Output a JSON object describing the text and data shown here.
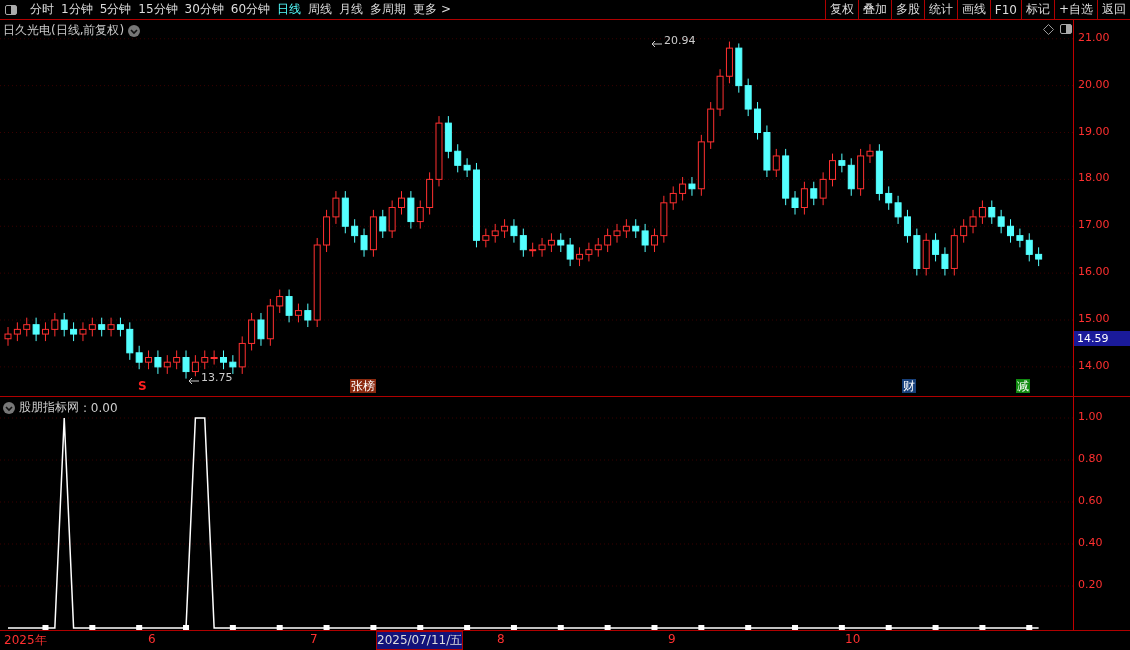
{
  "toolbar": {
    "periods": [
      {
        "label": "分时",
        "selected": false
      },
      {
        "label": "1分钟",
        "selected": false
      },
      {
        "label": "5分钟",
        "selected": false
      },
      {
        "label": "15分钟",
        "selected": false
      },
      {
        "label": "30分钟",
        "selected": false
      },
      {
        "label": "60分钟",
        "selected": false
      },
      {
        "label": "日线",
        "selected": true
      },
      {
        "label": "周线",
        "selected": false
      },
      {
        "label": "月线",
        "selected": false
      },
      {
        "label": "多周期",
        "selected": false
      },
      {
        "label": "更多 >",
        "selected": false
      }
    ],
    "actions": [
      "复权",
      "叠加",
      "多股",
      "统计",
      "画线",
      "F10",
      "标记",
      "+自选",
      "返回"
    ]
  },
  "main_chart": {
    "title": "日久光电(日线,前复权)",
    "last_price": "14.59",
    "high_label": "20.94",
    "low_label": "13.75",
    "chart_data": {
      "type": "candlestick",
      "grid": true,
      "ylim": [
        13.4,
        21.4
      ],
      "yticks": [
        {
          "value": 21,
          "label": "21.00"
        },
        {
          "value": 20,
          "label": "20.00"
        },
        {
          "value": 19,
          "label": "19.00"
        },
        {
          "value": 18,
          "label": "18.00"
        },
        {
          "value": 17,
          "label": "17.00"
        },
        {
          "value": 16,
          "label": "16.00"
        },
        {
          "value": 15,
          "label": "15.00"
        },
        {
          "value": 14,
          "label": "14.00"
        }
      ],
      "ohlc": [
        [
          14.6,
          14.85,
          14.45,
          14.7
        ],
        [
          14.7,
          14.95,
          14.55,
          14.8
        ],
        [
          14.8,
          15.05,
          14.65,
          14.9
        ],
        [
          14.9,
          15.05,
          14.55,
          14.7
        ],
        [
          14.7,
          14.95,
          14.55,
          14.8
        ],
        [
          14.8,
          15.15,
          14.65,
          15.0
        ],
        [
          15.0,
          15.15,
          14.65,
          14.8
        ],
        [
          14.8,
          14.95,
          14.55,
          14.7
        ],
        [
          14.7,
          14.95,
          14.55,
          14.8
        ],
        [
          14.8,
          15.05,
          14.65,
          14.9
        ],
        [
          14.9,
          15.05,
          14.65,
          14.8
        ],
        [
          14.8,
          15.05,
          14.65,
          14.9
        ],
        [
          14.9,
          15.05,
          14.65,
          14.8
        ],
        [
          14.8,
          14.95,
          14.15,
          14.3
        ],
        [
          14.3,
          14.45,
          13.95,
          14.1
        ],
        [
          14.1,
          14.35,
          13.95,
          14.2
        ],
        [
          14.2,
          14.35,
          13.85,
          14.0
        ],
        [
          14.0,
          14.25,
          13.85,
          14.1
        ],
        [
          14.1,
          14.35,
          13.95,
          14.2
        ],
        [
          14.2,
          14.35,
          13.75,
          13.9
        ],
        [
          13.9,
          14.25,
          13.8,
          14.1
        ],
        [
          14.1,
          14.35,
          13.95,
          14.2
        ],
        [
          14.2,
          14.35,
          14.05,
          14.2
        ],
        [
          14.2,
          14.35,
          13.95,
          14.1
        ],
        [
          14.1,
          14.25,
          13.85,
          14.0
        ],
        [
          14.0,
          14.65,
          13.85,
          14.5
        ],
        [
          14.5,
          15.15,
          14.35,
          15.0
        ],
        [
          15.0,
          15.15,
          14.45,
          14.6
        ],
        [
          14.6,
          15.45,
          14.45,
          15.3
        ],
        [
          15.3,
          15.65,
          15.15,
          15.5
        ],
        [
          15.5,
          15.65,
          14.95,
          15.1
        ],
        [
          15.1,
          15.35,
          14.95,
          15.2
        ],
        [
          15.2,
          15.35,
          14.85,
          15.0
        ],
        [
          15.0,
          16.75,
          14.85,
          16.6
        ],
        [
          16.6,
          17.35,
          16.45,
          17.2
        ],
        [
          17.2,
          17.75,
          17.05,
          17.6
        ],
        [
          17.6,
          17.75,
          16.85,
          17.0
        ],
        [
          17.0,
          17.15,
          16.65,
          16.8
        ],
        [
          16.8,
          16.95,
          16.35,
          16.5
        ],
        [
          16.5,
          17.35,
          16.35,
          17.2
        ],
        [
          17.2,
          17.35,
          16.75,
          16.9
        ],
        [
          16.9,
          17.55,
          16.75,
          17.4
        ],
        [
          17.4,
          17.75,
          17.25,
          17.6
        ],
        [
          17.6,
          17.75,
          16.95,
          17.1
        ],
        [
          17.1,
          17.55,
          16.95,
          17.4
        ],
        [
          17.4,
          18.15,
          17.25,
          18.0
        ],
        [
          18.0,
          19.35,
          17.85,
          19.2
        ],
        [
          19.2,
          19.35,
          18.45,
          18.6
        ],
        [
          18.6,
          18.75,
          18.15,
          18.3
        ],
        [
          18.3,
          18.45,
          18.05,
          18.2
        ],
        [
          18.2,
          18.35,
          16.55,
          16.7
        ],
        [
          16.7,
          16.95,
          16.55,
          16.8
        ],
        [
          16.8,
          17.05,
          16.65,
          16.9
        ],
        [
          16.9,
          17.15,
          16.75,
          17.0
        ],
        [
          17.0,
          17.15,
          16.65,
          16.8
        ],
        [
          16.8,
          16.95,
          16.35,
          16.5
        ],
        [
          16.5,
          16.65,
          16.35,
          16.5
        ],
        [
          16.5,
          16.75,
          16.35,
          16.6
        ],
        [
          16.6,
          16.85,
          16.45,
          16.7
        ],
        [
          16.7,
          16.85,
          16.45,
          16.6
        ],
        [
          16.6,
          16.75,
          16.15,
          16.3
        ],
        [
          16.3,
          16.55,
          16.15,
          16.4
        ],
        [
          16.4,
          16.65,
          16.25,
          16.5
        ],
        [
          16.5,
          16.75,
          16.35,
          16.6
        ],
        [
          16.6,
          16.95,
          16.45,
          16.8
        ],
        [
          16.8,
          17.05,
          16.65,
          16.9
        ],
        [
          16.9,
          17.15,
          16.75,
          17.0
        ],
        [
          17.0,
          17.15,
          16.75,
          16.9
        ],
        [
          16.9,
          17.05,
          16.45,
          16.6
        ],
        [
          16.6,
          16.95,
          16.45,
          16.8
        ],
        [
          16.8,
          17.65,
          16.65,
          17.5
        ],
        [
          17.5,
          17.85,
          17.35,
          17.7
        ],
        [
          17.7,
          18.05,
          17.55,
          17.9
        ],
        [
          17.9,
          18.05,
          17.65,
          17.8
        ],
        [
          17.8,
          18.95,
          17.65,
          18.8
        ],
        [
          18.8,
          19.65,
          18.65,
          19.5
        ],
        [
          19.5,
          20.35,
          19.35,
          20.2
        ],
        [
          20.2,
          20.94,
          20.05,
          20.8
        ],
        [
          20.8,
          20.9,
          19.85,
          20.0
        ],
        [
          20.0,
          20.15,
          19.35,
          19.5
        ],
        [
          19.5,
          19.65,
          18.85,
          19.0
        ],
        [
          19.0,
          19.15,
          18.05,
          18.2
        ],
        [
          18.2,
          18.65,
          18.05,
          18.5
        ],
        [
          18.5,
          18.65,
          17.45,
          17.6
        ],
        [
          17.6,
          17.75,
          17.25,
          17.4
        ],
        [
          17.4,
          17.95,
          17.25,
          17.8
        ],
        [
          17.8,
          17.95,
          17.45,
          17.6
        ],
        [
          17.6,
          18.15,
          17.45,
          18.0
        ],
        [
          18.0,
          18.55,
          17.85,
          18.4
        ],
        [
          18.4,
          18.55,
          18.15,
          18.3
        ],
        [
          18.3,
          18.45,
          17.65,
          17.8
        ],
        [
          17.8,
          18.65,
          17.65,
          18.5
        ],
        [
          18.5,
          18.75,
          18.35,
          18.6
        ],
        [
          18.6,
          18.75,
          17.55,
          17.7
        ],
        [
          17.7,
          17.85,
          17.35,
          17.5
        ],
        [
          17.5,
          17.65,
          17.05,
          17.2
        ],
        [
          17.2,
          17.35,
          16.65,
          16.8
        ],
        [
          16.8,
          16.95,
          15.95,
          16.1
        ],
        [
          16.1,
          16.85,
          15.95,
          16.7
        ],
        [
          16.7,
          16.85,
          16.25,
          16.4
        ],
        [
          16.4,
          16.55,
          15.95,
          16.1
        ],
        [
          16.1,
          16.95,
          15.95,
          16.8
        ],
        [
          16.8,
          17.15,
          16.65,
          17.0
        ],
        [
          17.0,
          17.35,
          16.85,
          17.2
        ],
        [
          17.2,
          17.55,
          17.05,
          17.4
        ],
        [
          17.4,
          17.55,
          17.05,
          17.2
        ],
        [
          17.2,
          17.35,
          16.85,
          17.0
        ],
        [
          17.0,
          17.15,
          16.65,
          16.8
        ],
        [
          16.8,
          16.95,
          16.55,
          16.7
        ],
        [
          16.7,
          16.85,
          16.25,
          16.4
        ],
        [
          16.4,
          16.55,
          16.15,
          16.3
        ]
      ]
    },
    "markers": [
      {
        "text": "S",
        "kind": "text",
        "color": "#ff2020"
      },
      {
        "text": "张榜",
        "kind": "tag",
        "color": "#8b2a10"
      },
      {
        "text": "财",
        "kind": "tag",
        "color": "#17407a"
      },
      {
        "text": "减",
        "kind": "tag",
        "color": "#108a10"
      }
    ]
  },
  "indicator": {
    "value": ": 0.00",
    "chart_data": {
      "type": "line",
      "grid": true,
      "ylim": [
        0,
        1
      ],
      "yticks": [
        {
          "value": 1,
          "label": "1.00"
        },
        {
          "value": 0.8,
          "label": "0.80"
        },
        {
          "value": 0.6,
          "label": "0.60"
        },
        {
          "value": 0.4,
          "label": "0.40"
        },
        {
          "value": 0.2,
          "label": "0.20"
        }
      ],
      "series": [
        {
          "name": "股朋指标网",
          "color": "#ffffff",
          "values": [
            0,
            0,
            0,
            0,
            0,
            0,
            1,
            0,
            0,
            0,
            0,
            0,
            0,
            0,
            0,
            0,
            0,
            0,
            0,
            0,
            1,
            1,
            0,
            0,
            0,
            0,
            0,
            0,
            0,
            0,
            0,
            0,
            0,
            0,
            0,
            0,
            0,
            0,
            0,
            0,
            0,
            0,
            0,
            0,
            0,
            0,
            0,
            0,
            0,
            0,
            0,
            0,
            0,
            0,
            0,
            0,
            0,
            0,
            0,
            0,
            0,
            0,
            0,
            0,
            0,
            0,
            0,
            0,
            0,
            0,
            0,
            0,
            0,
            0,
            0,
            0,
            0,
            0,
            0,
            0,
            0,
            0,
            0,
            0,
            0,
            0,
            0,
            0,
            0,
            0,
            0,
            0,
            0,
            0,
            0,
            0,
            0,
            0,
            0,
            0,
            0,
            0,
            0,
            0,
            0,
            0,
            0,
            0,
            0,
            0,
            0
          ]
        }
      ]
    }
  },
  "date_axis": {
    "labels": [
      {
        "text": "2025年",
        "kind": "tick"
      },
      {
        "text": "6",
        "kind": "tick"
      },
      {
        "text": "7",
        "kind": "tick"
      },
      {
        "text": "2025/07/11/五",
        "kind": "cursor"
      },
      {
        "text": "8",
        "kind": "tick"
      },
      {
        "text": "9",
        "kind": "tick"
      },
      {
        "text": "10",
        "kind": "tick"
      }
    ]
  }
}
